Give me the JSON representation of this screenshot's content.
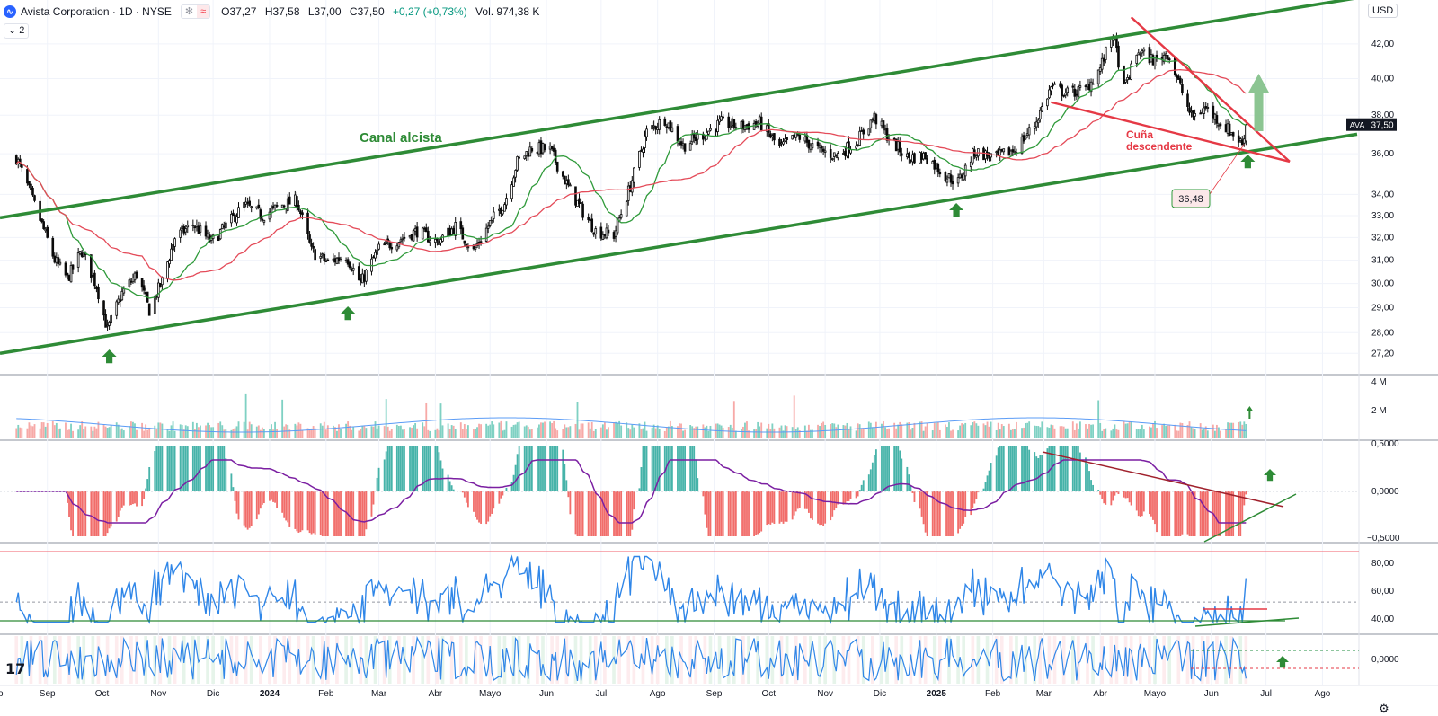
{
  "header": {
    "logo_glyph": "∿",
    "title": "Avista Corporation · 1D · NYSE",
    "badge_1": "✻",
    "badge_2": "≈",
    "open": "O37,27",
    "high": "H37,58",
    "low": "L37,00",
    "close": "C37,50",
    "change": "+0,27 (+0,73%)",
    "volume": "Vol. 974,38 K",
    "collapse_label": "⌄ 2",
    "currency": "USD"
  },
  "footer": {
    "tv_logo": "17",
    "settings_glyph": "⚙"
  },
  "colors": {
    "channel": "#2e8b36",
    "wedge": "#e53945",
    "candle_up": "#0b0b0b",
    "ma_fast": "#2f9a3a",
    "ma_slow": "#e44b59",
    "hist_up": "#26a69a",
    "hist_down": "#ef5350",
    "macd_line": "#7b1fa2",
    "rsi_line": "#2f86e8",
    "arrow": "#2e8b36"
  },
  "chart_data": {
    "type": "candlestick",
    "symbol": "AVA",
    "scale": "log",
    "ylim": [
      26.8,
      44.0
    ],
    "y_ticks": [
      "42,00",
      "40,00",
      "38,00",
      "36,00",
      "34,00",
      "33,00",
      "32,00",
      "31,00",
      "30,00",
      "29,00",
      "28,00",
      "27,20"
    ],
    "x_ticks": [
      "go",
      "Sep",
      "Oct",
      "Nov",
      "Dic",
      "2024",
      "Feb",
      "Mar",
      "Abr",
      "Mayo",
      "Jun",
      "Jul",
      "Ago",
      "Sep",
      "Oct",
      "Nov",
      "Dic",
      "2025",
      "Feb",
      "Mar",
      "Abr",
      "Mayo",
      "Jun",
      "Jul",
      "Ago"
    ],
    "last_price": "37,50",
    "last_price_symbol": "AVA",
    "price_path": [
      [
        "2023-08-15",
        35.8
      ],
      [
        "2023-08-25",
        33.5
      ],
      [
        "2023-09-05",
        31.0
      ],
      [
        "2023-09-12",
        30.2
      ],
      [
        "2023-09-20",
        31.4
      ],
      [
        "2023-09-28",
        29.9
      ],
      [
        "2023-10-04",
        28.1
      ],
      [
        "2023-10-12",
        29.6
      ],
      [
        "2023-10-20",
        30.4
      ],
      [
        "2023-10-27",
        28.9
      ],
      [
        "2023-11-03",
        30.1
      ],
      [
        "2023-11-10",
        32.0
      ],
      [
        "2023-11-20",
        32.6
      ],
      [
        "2023-11-30",
        31.8
      ],
      [
        "2023-12-10",
        32.7
      ],
      [
        "2023-12-18",
        33.5
      ],
      [
        "2023-12-28",
        33.0
      ],
      [
        "2024-01-08",
        33.5
      ],
      [
        "2024-01-16",
        33.7
      ],
      [
        "2024-01-24",
        31.4
      ],
      [
        "2024-02-02",
        30.9
      ],
      [
        "2024-02-12",
        31.2
      ],
      [
        "2024-02-20",
        30.0
      ],
      [
        "2024-03-01",
        31.5
      ],
      [
        "2024-03-12",
        31.9
      ],
      [
        "2024-03-22",
        32.3
      ],
      [
        "2024-04-02",
        31.8
      ],
      [
        "2024-04-12",
        32.5
      ],
      [
        "2024-04-22",
        31.4
      ],
      [
        "2024-05-02",
        32.8
      ],
      [
        "2024-05-09",
        33.6
      ],
      [
        "2024-05-16",
        35.6
      ],
      [
        "2024-05-24",
        36.3
      ],
      [
        "2024-06-03",
        36.2
      ],
      [
        "2024-06-12",
        34.5
      ],
      [
        "2024-06-20",
        33.3
      ],
      [
        "2024-06-28",
        32.3
      ],
      [
        "2024-07-08",
        32.1
      ],
      [
        "2024-07-17",
        34.4
      ],
      [
        "2024-07-26",
        37.1
      ],
      [
        "2024-08-05",
        37.8
      ],
      [
        "2024-08-15",
        36.4
      ],
      [
        "2024-08-26",
        37.0
      ],
      [
        "2024-09-05",
        37.6
      ],
      [
        "2024-09-16",
        37.4
      ],
      [
        "2024-09-26",
        37.6
      ],
      [
        "2024-10-07",
        36.3
      ],
      [
        "2024-10-17",
        36.9
      ],
      [
        "2024-10-28",
        36.2
      ],
      [
        "2024-11-07",
        35.9
      ],
      [
        "2024-11-18",
        36.6
      ],
      [
        "2024-11-28",
        37.9
      ],
      [
        "2024-12-06",
        36.8
      ],
      [
        "2024-12-16",
        35.8
      ],
      [
        "2024-12-26",
        35.9
      ],
      [
        "2025-01-06",
        34.9
      ],
      [
        "2025-01-13",
        34.6
      ],
      [
        "2025-01-22",
        36.1
      ],
      [
        "2025-02-03",
        35.8
      ],
      [
        "2025-02-13",
        36.2
      ],
      [
        "2025-02-24",
        37.5
      ],
      [
        "2025-03-05",
        39.5
      ],
      [
        "2025-03-14",
        39.2
      ],
      [
        "2025-03-24",
        39.4
      ],
      [
        "2025-04-01",
        40.6
      ],
      [
        "2025-04-08",
        42.6
      ],
      [
        "2025-04-14",
        39.4
      ],
      [
        "2025-04-22",
        41.6
      ],
      [
        "2025-05-01",
        41.0
      ],
      [
        "2025-05-08",
        41.5
      ],
      [
        "2025-05-14",
        39.8
      ],
      [
        "2025-05-21",
        37.9
      ],
      [
        "2025-05-29",
        38.4
      ],
      [
        "2025-06-06",
        37.6
      ],
      [
        "2025-06-13",
        37.0
      ],
      [
        "2025-06-18",
        36.5
      ],
      [
        "2025-06-20",
        37.5
      ]
    ],
    "annotations": {
      "channel_label": "Canal alcista",
      "wedge_label_1": "Cuña",
      "wedge_label_2": "descendente",
      "callout_value": "36,48"
    },
    "volume_ticks": [
      "4 M",
      "2 M"
    ],
    "macd_ticks": [
      "0,5000",
      "0,0000",
      "−0,5000"
    ],
    "rsi_ticks": [
      "80,00",
      "60,00",
      "40,00"
    ],
    "osc_ticks": [
      "0,0000"
    ],
    "grid": true
  }
}
